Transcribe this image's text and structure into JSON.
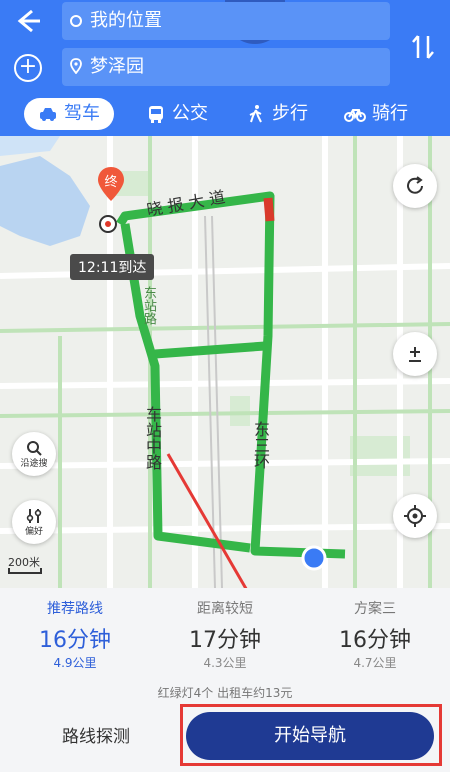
{
  "header": {
    "start_field": "我的位置",
    "end_field": "梦泽园",
    "modes": [
      {
        "label": "驾车",
        "icon": "car-icon",
        "active": true
      },
      {
        "label": "公交",
        "icon": "bus-icon",
        "active": false
      },
      {
        "label": "步行",
        "icon": "walk-icon",
        "active": false
      },
      {
        "label": "骑行",
        "icon": "bike-icon",
        "active": false
      }
    ]
  },
  "map": {
    "destination_marker": "终",
    "eta": "12:11到达",
    "road_labels": [
      "晓 报 大 道",
      "东三环",
      "车站中路",
      "东站路"
    ],
    "buttons": {
      "search_label": "沿途搜",
      "prefer_label": "偏好"
    },
    "scale": "200米",
    "route_color": "#35b649",
    "congestion_color": "#d93a2b"
  },
  "plans": [
    {
      "label": "推荐路线",
      "duration": "16分钟",
      "distance": "4.9公里",
      "active": true
    },
    {
      "label": "距离较短",
      "duration": "17分钟",
      "distance": "4.3公里",
      "active": false
    },
    {
      "label": "方案三",
      "duration": "16分钟",
      "distance": "4.7公里",
      "active": false
    }
  ],
  "info": "红绿灯4个  出租车约13元",
  "actions": {
    "explore": "路线探测",
    "start": "开始导航"
  }
}
